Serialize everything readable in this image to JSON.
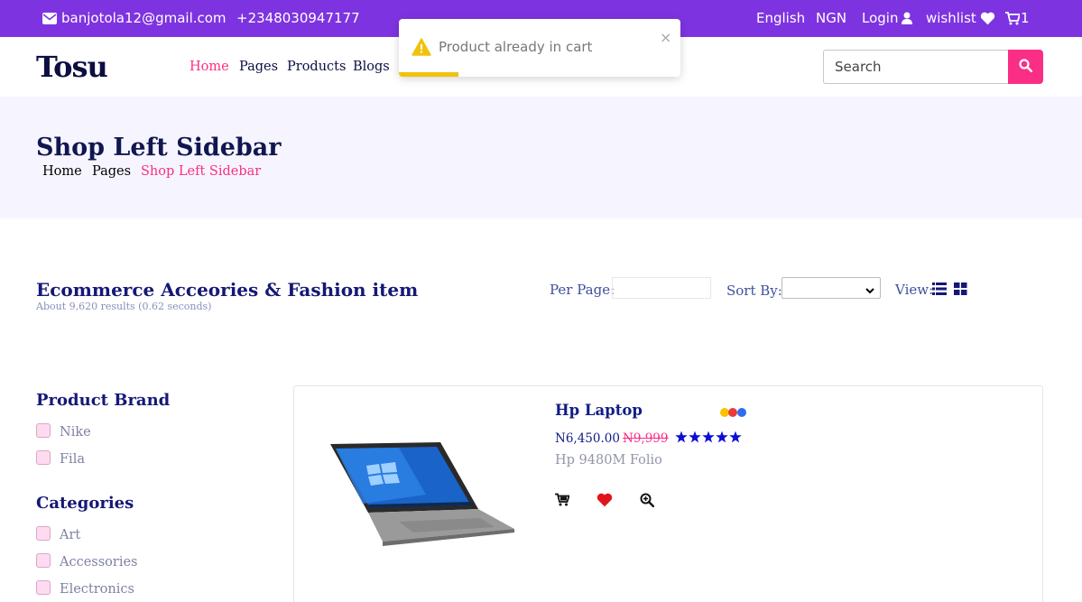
{
  "topbar": {
    "email": "banjotola12@gmail.com",
    "phone": "+2348030947177",
    "language": "English",
    "currency": "NGN",
    "login": "Login",
    "wishlist": "wishlist",
    "cart_count": "1"
  },
  "nav": {
    "logo": "Tosu",
    "links": [
      "Home",
      "Pages",
      "Products",
      "Blogs"
    ],
    "search_placeholder": "Search"
  },
  "toast": {
    "message": "Product already in cart",
    "close": "×"
  },
  "banner": {
    "title": "Shop Left Sidebar",
    "breadcrumb": [
      "Home",
      "Pages",
      "Shop Left Sidebar"
    ]
  },
  "toolbar": {
    "heading": "Ecommerce Acceories & Fashion item",
    "results": "About 9,620 results (0.62 seconds)",
    "per_page_label": "Per Page:",
    "sort_by_label": "Sort By:",
    "view_label": "View:"
  },
  "sidebar": {
    "brand_title": "Product Brand",
    "brands": [
      "Nike",
      "Fila"
    ],
    "categories_title": "Categories",
    "categories": [
      "Art",
      "Accessories",
      "Electronics"
    ]
  },
  "product": {
    "name": "Hp Laptop",
    "price": "N6,450.00",
    "old_price": "N9,999",
    "description": "Hp 9480M Folio",
    "rating": 5,
    "colors": [
      "#f9c300",
      "#ea3a3a",
      "#2f6df0"
    ]
  },
  "colors": {
    "accent": "#fb2e86",
    "topbar": "#7e33e0",
    "navy": "#151875"
  }
}
